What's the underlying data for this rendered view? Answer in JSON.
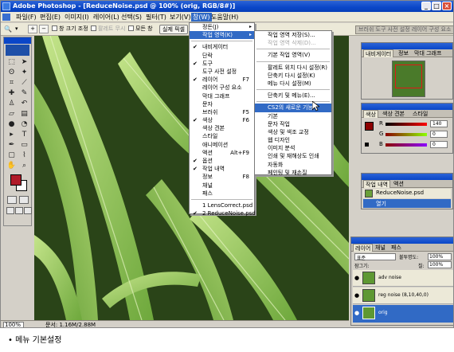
{
  "title_bar": {
    "title": "Adobe Photoshop - [ReduceNoise.psd @ 100% (orig, RGB/8#)]"
  },
  "menu_bar": {
    "items": [
      "파일(F)",
      "편집(E)",
      "이미지(I)",
      "레이어(L)",
      "선택(S)",
      "필터(T)",
      "보기(V)",
      "창(W)",
      "도움말(H)"
    ]
  },
  "options_bar": {
    "zoom_tool_glyph": "🔍",
    "resize_windows_label": "창 크기 조정",
    "ignore_palettes_label": "팔레트 무시",
    "all_windows_label": "모든 창",
    "actual_pixels_label": "실제 픽셀",
    "palette_well_text": "브러쉬 도구 사전 설정 레이어 구성 요소"
  },
  "window_menu": {
    "items": [
      {
        "label": "정돈(J)",
        "arrow": "▸"
      },
      {
        "label": "작업 영역(K)",
        "arrow": "▸",
        "highlight": true
      },
      {
        "sep": true
      },
      {
        "label": "내비게이터",
        "check": "✔"
      },
      {
        "label": "단락"
      },
      {
        "label": "도구",
        "check": "✔"
      },
      {
        "label": "도구 사전 설정"
      },
      {
        "label": "레이어",
        "check": "✔",
        "shortcut": "F7"
      },
      {
        "label": "레이어 구성 요소"
      },
      {
        "label": "막대 그래프"
      },
      {
        "label": "문자"
      },
      {
        "label": "브러쉬",
        "shortcut": "F5"
      },
      {
        "label": "색상",
        "check": "✔",
        "shortcut": "F6"
      },
      {
        "label": "색상 견본"
      },
      {
        "label": "스타일"
      },
      {
        "label": "애니메이션"
      },
      {
        "label": "액션",
        "shortcut": "Alt+F9"
      },
      {
        "label": "옵션",
        "check": "✔"
      },
      {
        "label": "작업 내역",
        "check": "✔"
      },
      {
        "label": "정보",
        "shortcut": "F8"
      },
      {
        "label": "채널"
      },
      {
        "label": "패스"
      },
      {
        "sep": true
      },
      {
        "label": "1 LensCorrect.psd"
      },
      {
        "label": "2 ReduceNoise.psd",
        "check": "✔"
      }
    ]
  },
  "workspace_menu": {
    "items": [
      {
        "label": "작업 영역 저장(S)..."
      },
      {
        "label": "작업 영역 삭제(D)...",
        "dim": true
      },
      {
        "sep": true
      },
      {
        "label": "기본 작업 영역(V)"
      },
      {
        "sep": true
      },
      {
        "label": "팔레트 위치 다시 설정(R)"
      },
      {
        "label": "단축키 다시 설정(K)"
      },
      {
        "label": "메뉴 다시 설정(M)"
      },
      {
        "sep": true
      },
      {
        "label": "단축키 및 메뉴(E)..."
      },
      {
        "sep": true
      },
      {
        "label": "CS2의 새로운 기능",
        "highlight": true
      },
      {
        "label": "기본"
      },
      {
        "label": "문자 작업"
      },
      {
        "label": "색상 및 색조 교정"
      },
      {
        "label": "웹 디자인"
      },
      {
        "label": "이미지 분석"
      },
      {
        "label": "인쇄 및 재해상도 인쇄"
      },
      {
        "label": "자동화"
      },
      {
        "label": "페인팅 및 재손질"
      }
    ]
  },
  "navigator_palette": {
    "tabs": [
      "내비게이터",
      "정보",
      "막대 그래프"
    ]
  },
  "color_palette": {
    "tabs": [
      "색상",
      "색상 견본",
      "스타일"
    ],
    "channels": [
      {
        "label": "R",
        "value": "140"
      },
      {
        "label": "G",
        "value": "0"
      },
      {
        "label": "B",
        "value": "0"
      }
    ],
    "fg_color": "#8c0000"
  },
  "history_palette": {
    "tabs": [
      "작업 내역",
      "액션"
    ],
    "snapshot": "ReduceNoise.psd",
    "step": "열기"
  },
  "layers_palette": {
    "tabs": [
      "레이어",
      "채널",
      "패스"
    ],
    "blend_mode": "표준",
    "opacity_label": "불투명도:",
    "opacity": "100%",
    "lock_label": "잠그기:",
    "fill_label": "칠:",
    "fill": "100%",
    "layers": [
      {
        "name": "adv noise",
        "selected": false
      },
      {
        "name": "reg noise (8,10,40,0)",
        "selected": false
      },
      {
        "name": "orig",
        "selected": true
      }
    ]
  },
  "status_bar": {
    "zoom": "100%",
    "doc_info": "문서: 1.16M/2.88M"
  },
  "caption": "• 메뉴 기본설정",
  "colors": {
    "title_blue": "#0a46c8",
    "highlight": "#316ac5",
    "leaf_light": "#a8d46a",
    "leaf_dark": "#2e4a1e"
  }
}
